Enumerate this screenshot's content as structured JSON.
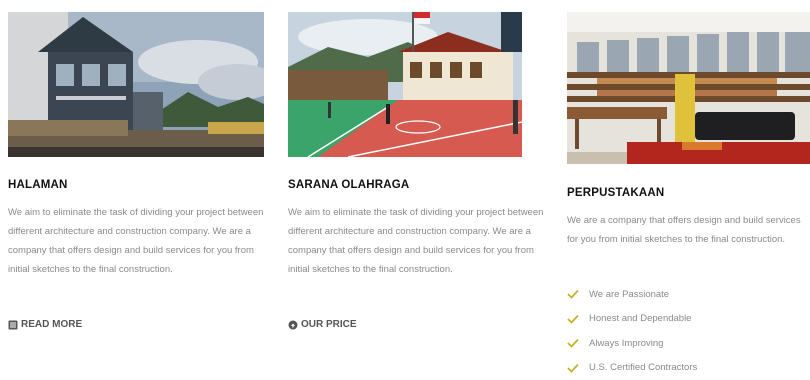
{
  "columns": [
    {
      "title": "HALAMAN",
      "description": "We aim to eliminate the task of dividing your project between different architecture and construction company. We are a company that offers design and build services for you from initial sketches to the final construction.",
      "button": {
        "label": "READ MORE",
        "icon": "book-icon"
      }
    },
    {
      "title": "SARANA OLAHRAGA",
      "description": "We aim to eliminate the task of dividing your project between different architecture and construction company. We are a company that offers design and build services for you from initial sketches to the final construction.",
      "button": {
        "label": "OUR PRICE",
        "icon": "cloud-icon"
      }
    },
    {
      "title": "PERPUSTAKAAN",
      "description": "We are a company that offers design and build services for you from initial sketches to the final construction.",
      "features": [
        "We are Passionate",
        "Honest and Dependable",
        "Always Improving",
        "U.S. Certified Contractors"
      ]
    }
  ],
  "colors": {
    "check": "#c8b02a",
    "heading": "#111111",
    "text": "#8a8a8a"
  }
}
